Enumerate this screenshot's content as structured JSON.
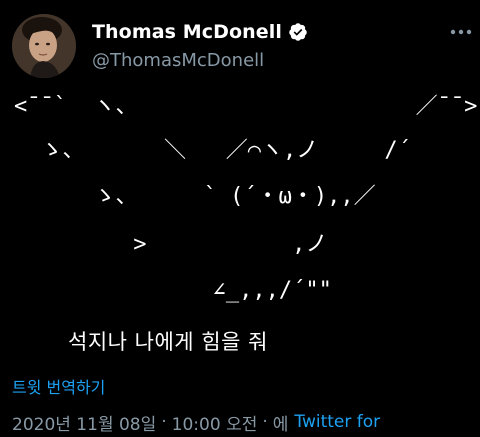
{
  "author": {
    "display_name": "Thomas McDonell",
    "handle": "@ThomasMcDonell",
    "verified": true,
    "verified_icon": "verified-badge-icon",
    "avatar": "profile-photo"
  },
  "more_icon": "more-options-icon",
  "tweet": {
    "ascii_lines": [
      "<¯¯`  ヽ、                     ／¯¯>",
      "  ゝ、      ＼   ／⌒ヽ,ノ     /´",
      "      ゝ、     ` (´・ω・),,／",
      "         >           ,ノ",
      "               ∠_,,,/´\"\""
    ],
    "caption": "석지나 나에게 힘을 줘"
  },
  "translate_label": "트윗 번역하기",
  "meta": {
    "date": "2020년 11월 08일",
    "separator": "·",
    "time": "10:00 오전",
    "via_prefix": "에",
    "source": "Twitter for"
  },
  "colors": {
    "background": "#000000",
    "text": "#ffffff",
    "secondary": "#8899a6",
    "link": "#1da1f2",
    "verified": "#1da1f2"
  }
}
